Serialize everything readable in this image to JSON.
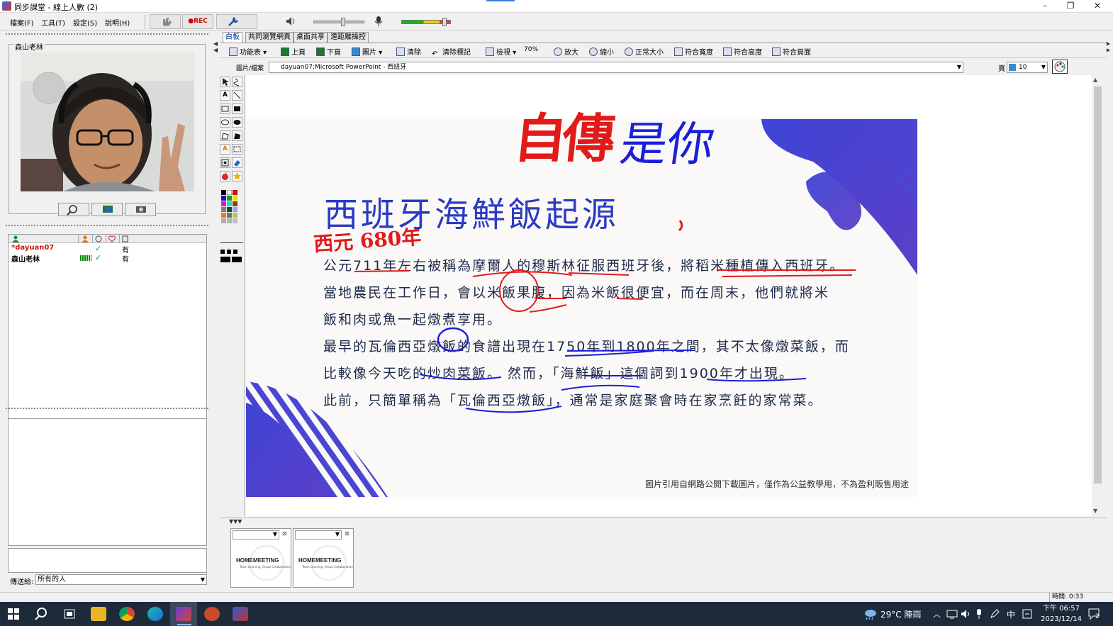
{
  "window": {
    "title": "同步課堂 - 線上人數 (2)",
    "controls": [
      "–",
      "❐",
      "✕"
    ]
  },
  "menu": [
    "檔案(F)",
    "工具(T)",
    "設定(S)",
    "說明(H)"
  ],
  "top_toolbar": {
    "rec_label": "●REC"
  },
  "video": {
    "title": "森山老林"
  },
  "participants": {
    "rows": [
      {
        "name": "*dayuan07",
        "status": "✓",
        "value": "有"
      },
      {
        "name": "森山老林",
        "status": "✓",
        "value": "有"
      }
    ]
  },
  "send_to": {
    "label": "傳送給:",
    "value": "所有的人"
  },
  "tabs": [
    "白板",
    "共同瀏覽網頁",
    "桌面共享",
    "遠距離操控"
  ],
  "toolbar2": {
    "func": "功能表",
    "prev": "上頁",
    "next": "下頁",
    "image": "圖片",
    "clear": "清除",
    "clear_mark": "清除標記",
    "view": "檢視",
    "zoom": "70%",
    "zoom_in": "放大",
    "zoom_out": "縮小",
    "normal": "正常大小",
    "fit_w": "符合寬度",
    "fit_h": "符合高度",
    "fit_p": "符合頁面"
  },
  "file_row": {
    "label": "圖片/檔案",
    "value": "dayuan07:Microsoft PowerPoint - 西班牙",
    "page_label": "頁",
    "page_value": "10"
  },
  "slide": {
    "title": "西班牙海鮮飯起源",
    "lines": [
      "公元711年左右被稱為摩爾人的穆斯林征服西班牙後，將稻米種植傳入西班牙。",
      "當地農民在工作日，會以米飯果腹，因為米飯很便宜，而在周末，他們就將米",
      "飯和肉或魚一起燉煮享用。",
      "最早的瓦倫西亞燉飯的食譜出現在1750年到1800年之間，其不太像燉菜飯，而",
      "比較像今天吃的炒肉菜飯。 然而，「海鮮飯」這個詞到1900年才出現。",
      "此前，只簡單稱為「瓦倫西亞燉飯」，通常是家庭聚會時在家烹飪的家常菜。"
    ],
    "footnote": "圖片引用自網路公開下載圖片，僅作為公益教學用，不為盈利販售用途"
  },
  "annotations": {
    "red_title": "自傳",
    "blue_title": "是你",
    "red_note": "西元 680年"
  },
  "thumbs": [
    {
      "logo": "HOMEMEETING",
      "sub": "Team Learning, Group Collaboration"
    },
    {
      "logo": "HOMEMEETING",
      "sub": "Team Learning, Group Collaboration"
    }
  ],
  "status": {
    "time": "時間: 0:33"
  },
  "taskbar": {
    "weather": "29°C  陣雨",
    "ime": "中",
    "clock_time": "下午 06:57",
    "clock_date": "2023/12/14",
    "notif": "2"
  },
  "colors": {
    "accent": "#3d7bd6",
    "slide_text": "#1e2a4a",
    "ink_red": "#e21a1a",
    "ink_blue": "#1b1fd6",
    "deco": "#4a3fd0"
  }
}
